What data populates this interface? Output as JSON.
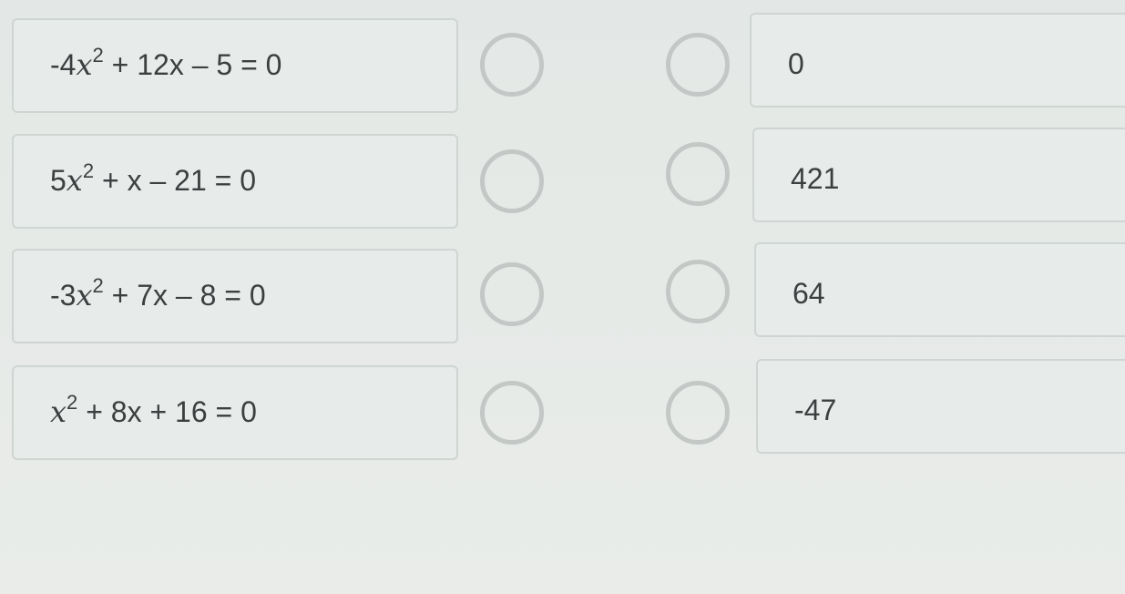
{
  "equations": [
    {
      "sign": "-",
      "coef": "4",
      "var": "x",
      "exp": "2",
      "rest": " + 12x – 5 = 0"
    },
    {
      "sign": "",
      "coef": "5",
      "var": "x",
      "exp": "2",
      "rest": " + x – 21 = 0"
    },
    {
      "sign": "-",
      "coef": "3",
      "var": "x",
      "exp": "2",
      "rest": " + 7x – 8 = 0"
    },
    {
      "sign": "",
      "coef": "",
      "var": "x",
      "exp": "2",
      "rest": " + 8x + 16 = 0"
    }
  ],
  "answers": [
    "0",
    "421",
    "64",
    "-47"
  ],
  "colors": {
    "background": "#e5e9e7",
    "card_border": "#cfd5d3",
    "radio_ring": "#c3c8c6",
    "text": "#3c3f40"
  }
}
